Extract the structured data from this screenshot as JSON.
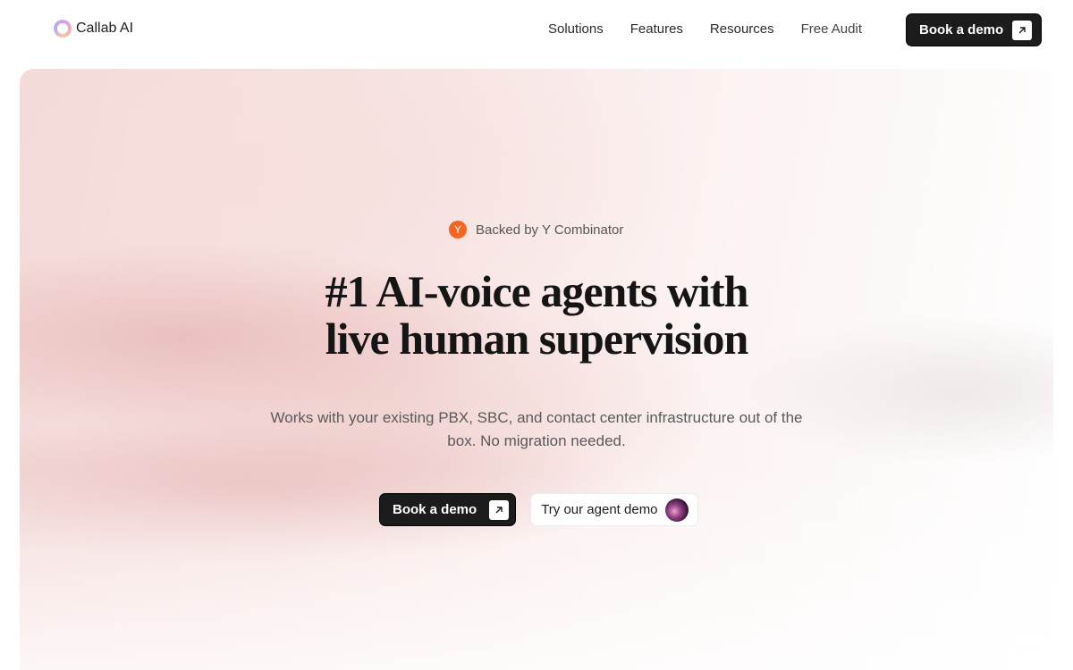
{
  "brand": {
    "name": "Callab AI"
  },
  "nav": {
    "items": [
      {
        "label": "Solutions"
      },
      {
        "label": "Features"
      },
      {
        "label": "Resources"
      },
      {
        "label": "Free Audit"
      }
    ],
    "cta_label": "Book a demo"
  },
  "hero": {
    "badge_icon_letter": "Y",
    "badge_text": "Backed by Y Combinator",
    "headline_line1": "#1 AI-voice agents with",
    "headline_line2": "live human supervision",
    "subtext": "Works with your existing PBX, SBC, and contact center infrastructure out of the box. No migration needed.",
    "primary_cta": "Book a demo",
    "secondary_cta": "Try our agent demo"
  },
  "colors": {
    "accent_dark": "#1c1c1c",
    "yc_orange": "#f26522"
  }
}
